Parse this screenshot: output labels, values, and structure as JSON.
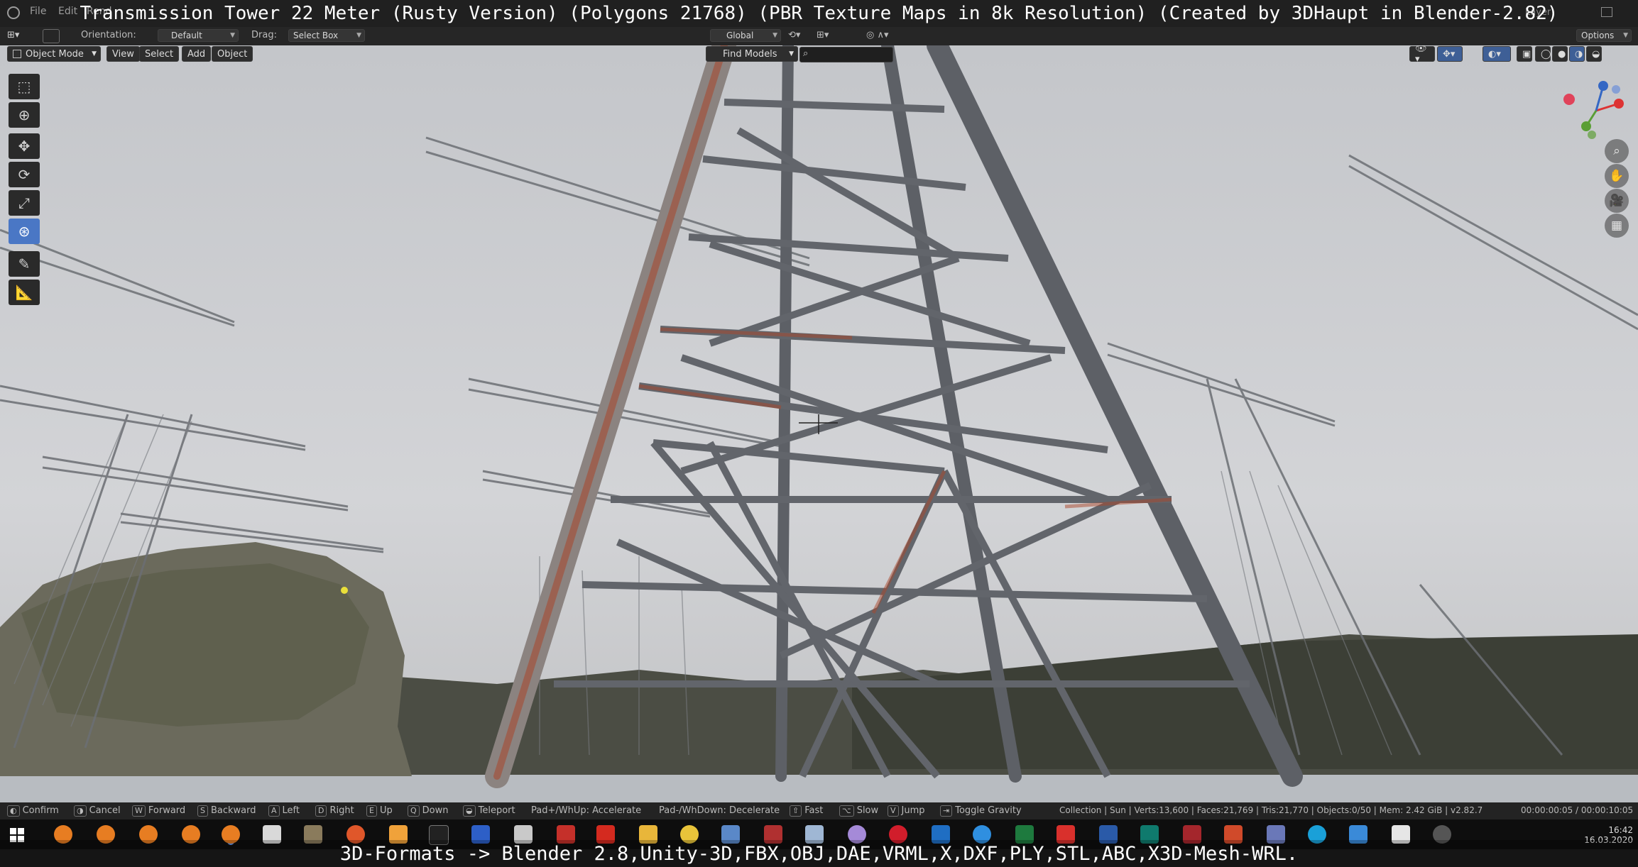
{
  "overlay": {
    "title": "Transmission Tower 22 Meter (Rusty Version) (Polygons 21768) (PBR Texture Maps in 8k Resolution) (Created by 3DHaupt in Blender-2.82)",
    "footer": "3D-Formats -> Blender 2.8,Unity-3D,FBX,OBJ,DAE,VRML,X,DXF,PLY,STL,ABC,X3D-Mesh-WRL."
  },
  "topbar": {
    "menu": [
      "File",
      "Edit",
      "Rend"
    ],
    "right_tab": "Layer",
    "options_label": "Options"
  },
  "header": {
    "orientation_label": "Orientation:",
    "orientation_value": "Default",
    "drag_label": "Drag:",
    "drag_value": "Select Box",
    "transform_value": "Global"
  },
  "viewport_header": {
    "mode": "Object Mode",
    "menus": [
      "View",
      "Select",
      "Add",
      "Object"
    ],
    "find_models": "Find Models"
  },
  "status": {
    "confirm": "Confirm",
    "cancel": "Cancel",
    "forward_key": "W",
    "forward": "Forward",
    "backward_key": "S",
    "backward": "Backward",
    "left_key": "A",
    "left": "Left",
    "right_key": "D",
    "right": "Right",
    "up_key": "E",
    "up": "Up",
    "down_key": "Q",
    "down": "Down",
    "teleport": "Teleport",
    "accelerate": "Pad+/WhUp: Accelerate",
    "decelerate": "Pad-/WhDown: Decelerate",
    "fast": "Fast",
    "slow": "Slow",
    "jump_key": "V",
    "jump": "Jump",
    "gravity": "Toggle Gravity",
    "stats": "Collection | Sun | Verts:13,600 | Faces:21,769 | Tris:21,770 | Objects:0/50 | Mem: 2.42 GiB | v2.82.7",
    "timer": "00:00:00:05 / 00:00:10:05"
  },
  "taskbar": {
    "time": "16:42",
    "date": "16.03.2020",
    "icons": [
      "windows-start",
      "blender",
      "blender",
      "blender",
      "blender",
      "blender",
      "unity",
      "gimp",
      "firefox",
      "app",
      "terminal",
      "save",
      "app",
      "app",
      "acrobat",
      "folder",
      "xnview",
      "app",
      "app",
      "app",
      "app",
      "opera",
      "outlook",
      "edge",
      "excel",
      "app",
      "word",
      "publisher",
      "access",
      "powerpoint",
      "app",
      "skype",
      "app",
      "unity",
      "app"
    ]
  },
  "colors": {
    "accent": "#4a77c5",
    "rust": "#a9462a",
    "steel": "#56595e"
  }
}
